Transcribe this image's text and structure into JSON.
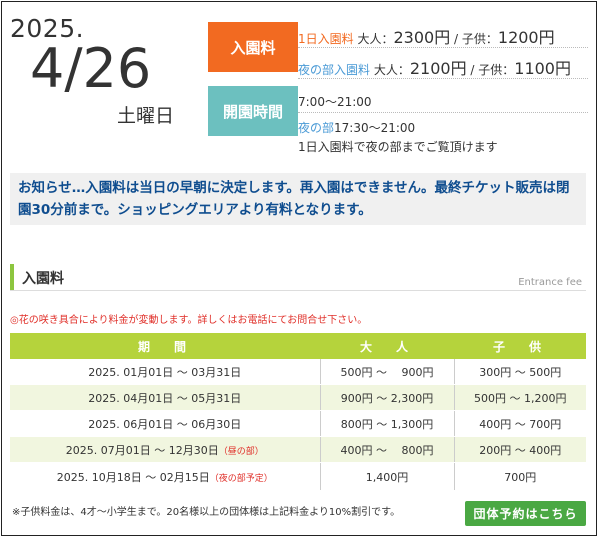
{
  "date": {
    "year": "2025.",
    "month_day": "4/26",
    "weekday": "土曜日"
  },
  "fee_tag": "入園料",
  "hours_tag": "開園時間",
  "fees": {
    "day_label": "1日入園料",
    "day_adult_label": " 大人：",
    "day_adult": "2300円",
    "day_child_label": " / 子供：",
    "day_child": "1200円",
    "night_label": "夜の部入園料",
    "night_adult_label": " 大人：",
    "night_adult": "2100円",
    "night_child_label": " / 子供：",
    "night_child": "1100円"
  },
  "hours": {
    "day": "7:00～21:00",
    "night_label": "夜の部",
    "night": "17:30～21:00",
    "note": "1日入園料で夜の部までご覧頂けます"
  },
  "notice": "お知らせ…入園料は当日の早朝に決定します。再入園はできません。最終チケット販売は閉園30分前まで。ショッピングエリアより有料となります。",
  "section": {
    "title": "入園料",
    "subtitle": "Entrance fee"
  },
  "caution": "◎花の咲き具合により料金が変動します。詳しくはお電話にてお問合せ下さい。",
  "table": {
    "headers": [
      "期　間",
      "大　人",
      "子　供"
    ],
    "rows": [
      {
        "period": "2025. 01月01日 〜 03月31日",
        "note": "",
        "adult": "500円 〜　 900円",
        "child": "300円 〜 500円"
      },
      {
        "period": "2025. 04月01日 〜 05月31日",
        "note": "",
        "adult": "900円 〜 2,300円",
        "child": "500円 〜 1,200円"
      },
      {
        "period": "2025. 06月01日 〜 06月30日",
        "note": "",
        "adult": "800円 〜 1,300円",
        "child": "400円 〜 700円"
      },
      {
        "period": "2025. 07月01日 〜 12月30日",
        "note": "（昼の部）",
        "adult": "400円 〜　 800円",
        "child": "200円 〜 400円"
      },
      {
        "period": "2025. 10月18日 〜 02月15日",
        "note": "（夜の部予定）",
        "adult": "1,400円",
        "child": "700円"
      }
    ]
  },
  "footnote": "※子供料金は、4才〜小学生まで。20名様以上の団体様は上記料金より10%割引です。",
  "group_button": "団体予約はこちら"
}
